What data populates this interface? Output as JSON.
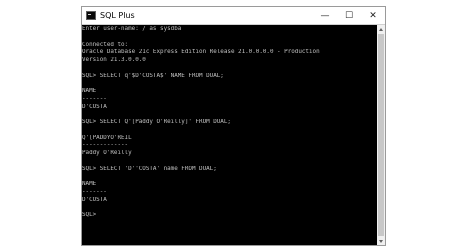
{
  "window": {
    "title": "SQL Plus",
    "controls": {
      "minimize": "—",
      "maximize": "☐",
      "close": "✕"
    }
  },
  "console": {
    "lines": [
      "Enter user-name: / as sysdba",
      "",
      "Connected to:",
      "Oracle Database 21c Express Edition Release 21.0.0.0.0 - Production",
      "Version 21.3.0.0.0",
      "",
      "SQL> SELECT q'$D'COSTA$' NAME FROM DUAL;",
      "",
      "NAME",
      "-------",
      "D'COSTA",
      "",
      "SQL> SELECT Q'[Paddy O'Reilly]' FROM DUAL;",
      "",
      "Q'[PADDYO'REIL",
      "-------------",
      "Paddy O'Reilly",
      "",
      "SQL> SELECT 'D''COSTA' name FROM DUAL;",
      "",
      "NAME",
      "-------",
      "D'COSTA",
      "",
      "SQL>",
      ""
    ]
  },
  "colors": {
    "terminal_bg": "#000000",
    "terminal_fg": "#c0c0c0",
    "titlebar_bg": "#ffffff"
  }
}
